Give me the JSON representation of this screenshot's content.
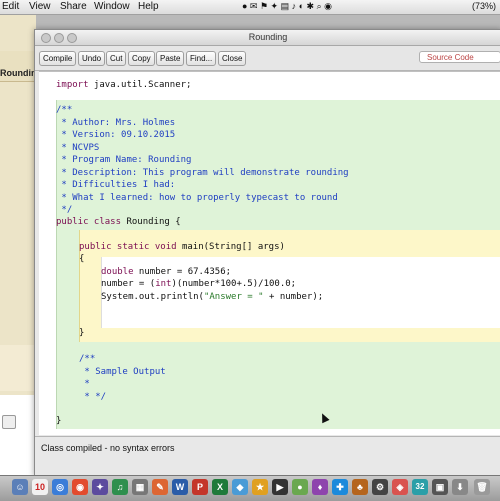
{
  "menubar": {
    "items": [
      "Edit",
      "View",
      "Share",
      "Window",
      "Help"
    ],
    "battery": "(73%)"
  },
  "background_window": {
    "label": "Roundin"
  },
  "window": {
    "title": "Rounding",
    "toolbar": {
      "buttons": [
        "Compile",
        "Undo",
        "Cut",
        "Copy",
        "Paste",
        "Find...",
        "Close"
      ],
      "view_select": "Source Code"
    }
  },
  "code": {
    "import_kw": "import",
    "import_rest": " java.util.Scanner;",
    "doc_comment": [
      "/**",
      " * Author: Mrs. Holmes",
      " * Version: 09.10.2015",
      " * NCVPS",
      " * Program Name: Rounding",
      " * Description: This program will demonstrate rounding",
      " * Difficulties I had:",
      " * What I learned: how to properly typecast to round",
      " */"
    ],
    "class_kw": "public class",
    "class_rest": " Rounding {",
    "method_kw": "public static void",
    "method_rest": " main(String[] args)",
    "open_brace": "{",
    "line1_kw": "double",
    "line1_rest": " number = 67.4356;",
    "line2_a": "number = (",
    "line2_kw": "int",
    "line2_b": ")(number*100+.5)/100.0;",
    "line3_a": "System.out.println(",
    "line3_str": "\"Answer = \"",
    "line3_b": " + number);",
    "close_method": "}",
    "sample_comment": [
      "/**",
      " * Sample Output",
      " *",
      " * */"
    ],
    "close_class": "}"
  },
  "status": "Class compiled - no syntax errors",
  "dock": {
    "calendar_day": "10",
    "badge": "32"
  }
}
